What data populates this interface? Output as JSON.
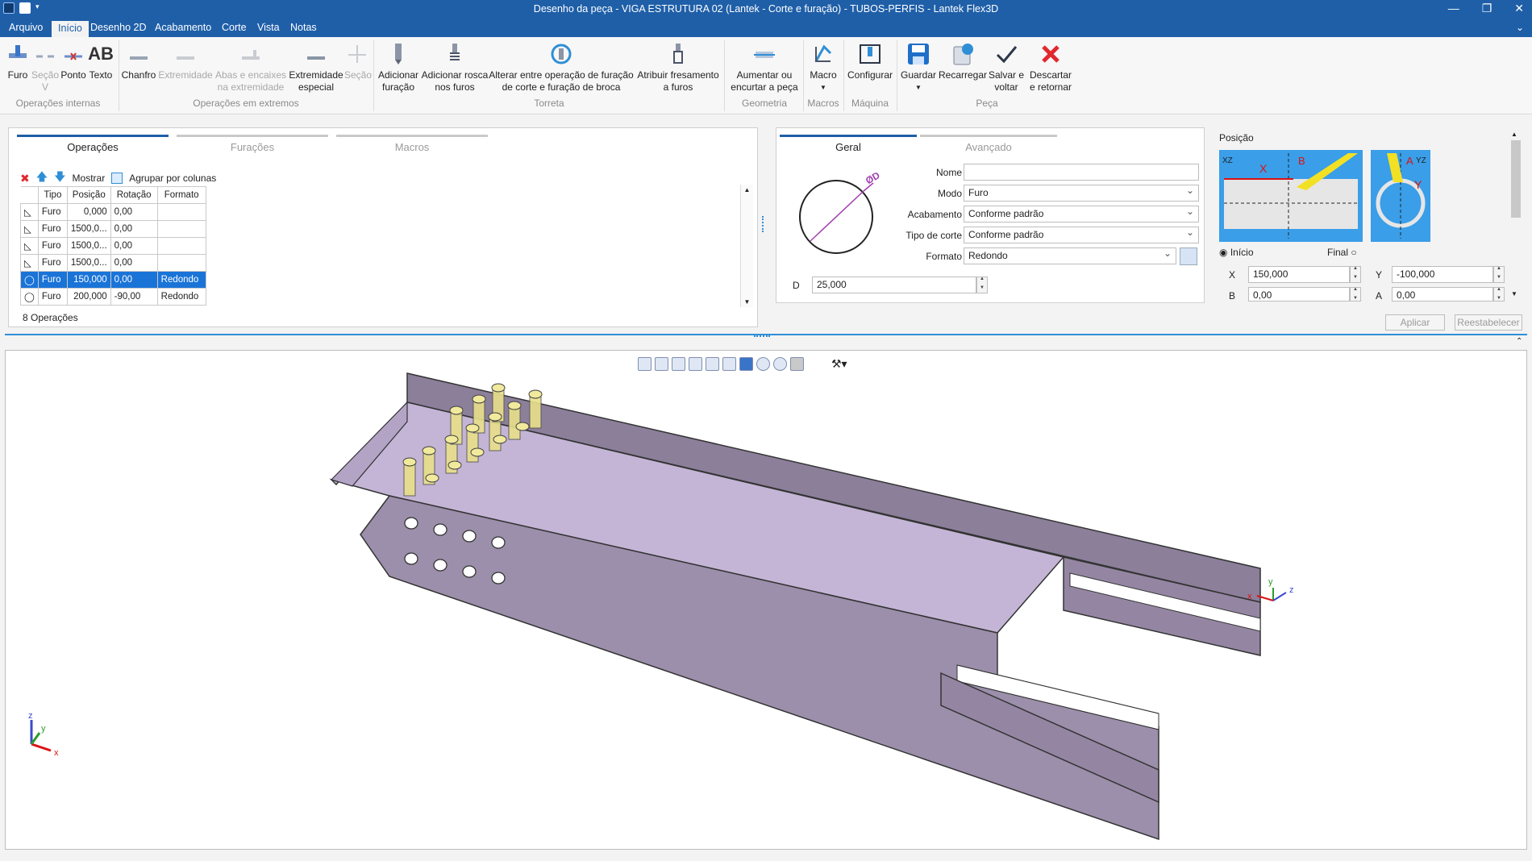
{
  "window": {
    "title": "Desenho da peça - VIGA ESTRUTURA 02 (Lantek  - Corte e furação) - TUBOS-PERFIS - Lantek Flex3D",
    "min": "—",
    "max": "❐",
    "close": "✕"
  },
  "menu": {
    "tabs": [
      "Arquivo",
      "Início",
      "Desenho 2D",
      "Acabamento",
      "Corte",
      "Vista",
      "Notas"
    ],
    "active": "Início"
  },
  "ribbon": {
    "buttons": {
      "furo": "Furo",
      "secaov": "Seção V",
      "ponto": "Ponto",
      "texto": "Texto",
      "texto_icon": "AB",
      "chanfro": "Chanfro",
      "extremidade": "Extremidade",
      "abas": "Abas e encaixes na extremidade",
      "extremidade_especial": "Extremidade especial",
      "secao": "Seção",
      "adicionar_furacao": "Adicionar furação",
      "adicionar_rosca": "Adicionar rosca nos furos",
      "alterar": "Alterar entre operação de furação de corte e furação de broca",
      "atribuir": "Atribuir fresamento a furos",
      "aumentar": "Aumentar ou encurtar a peça",
      "macro": "Macro",
      "configurar": "Configurar",
      "guardar": "Guardar",
      "recarregar": "Recarregar",
      "salvar": "Salvar e voltar",
      "descartar": "Descartar e retornar"
    },
    "groups": {
      "internas": "Operações internas",
      "extremos": "Operações em extremos",
      "torreta": "Torreta",
      "geometria": "Geometria",
      "macros": "Macros",
      "maquina": "Máquina",
      "peca": "Peça"
    }
  },
  "operations": {
    "tabs": [
      "Operações",
      "Furações",
      "Macros"
    ],
    "toolbar": {
      "mostrar": "Mostrar",
      "agrupar": "Agrupar por colunas"
    },
    "columns": [
      "Tipo",
      "Posição",
      "Rotação",
      "Formato"
    ],
    "rows": [
      {
        "tipo": "Furo",
        "posicao": "0,000",
        "rotacao": "0,00",
        "formato": ""
      },
      {
        "tipo": "Furo",
        "posicao": "1500,0...",
        "rotacao": "0,00",
        "formato": ""
      },
      {
        "tipo": "Furo",
        "posicao": "1500,0...",
        "rotacao": "0,00",
        "formato": ""
      },
      {
        "tipo": "Furo",
        "posicao": "1500,0...",
        "rotacao": "0,00",
        "formato": ""
      },
      {
        "tipo": "Furo",
        "posicao": "150,000",
        "rotacao": "0,00",
        "formato": "Redondo"
      },
      {
        "tipo": "Furo",
        "posicao": "200,000",
        "rotacao": "-90,00",
        "formato": "Redondo"
      }
    ],
    "count": "8 Operações"
  },
  "properties": {
    "tabs": [
      "Geral",
      "Avançado"
    ],
    "diagram_label": "ØD",
    "labels": {
      "nome": "Nome",
      "modo": "Modo",
      "acabamento": "Acabamento",
      "tipo_corte": "Tipo de corte",
      "formato": "Formato",
      "d": "D"
    },
    "values": {
      "nome": "",
      "modo": "Furo",
      "acabamento": "Conforme padrão",
      "tipo_corte": "Conforme padrão",
      "formato": "Redondo",
      "d": "25,000"
    }
  },
  "position": {
    "title": "Posição",
    "diagram1": {
      "x": "X",
      "b": "B",
      "xz": "XZ"
    },
    "diagram2": {
      "a": "A",
      "y": "Y",
      "yz": "YZ"
    },
    "inicio": "Início",
    "final": "Final",
    "x_label": "X",
    "x_value": "150,000",
    "y_label": "Y",
    "y_value": "-100,000",
    "b_label": "B",
    "b_value": "0,00",
    "a_label": "A",
    "a_value": "0,00",
    "aplicar": "Aplicar",
    "restabelecer": "Reestabelecer"
  },
  "viewport": {
    "axes": {
      "x": "x",
      "y": "y",
      "z": "z"
    },
    "part_color": "#9a8aa8",
    "hole_color": "#e8e08a"
  }
}
